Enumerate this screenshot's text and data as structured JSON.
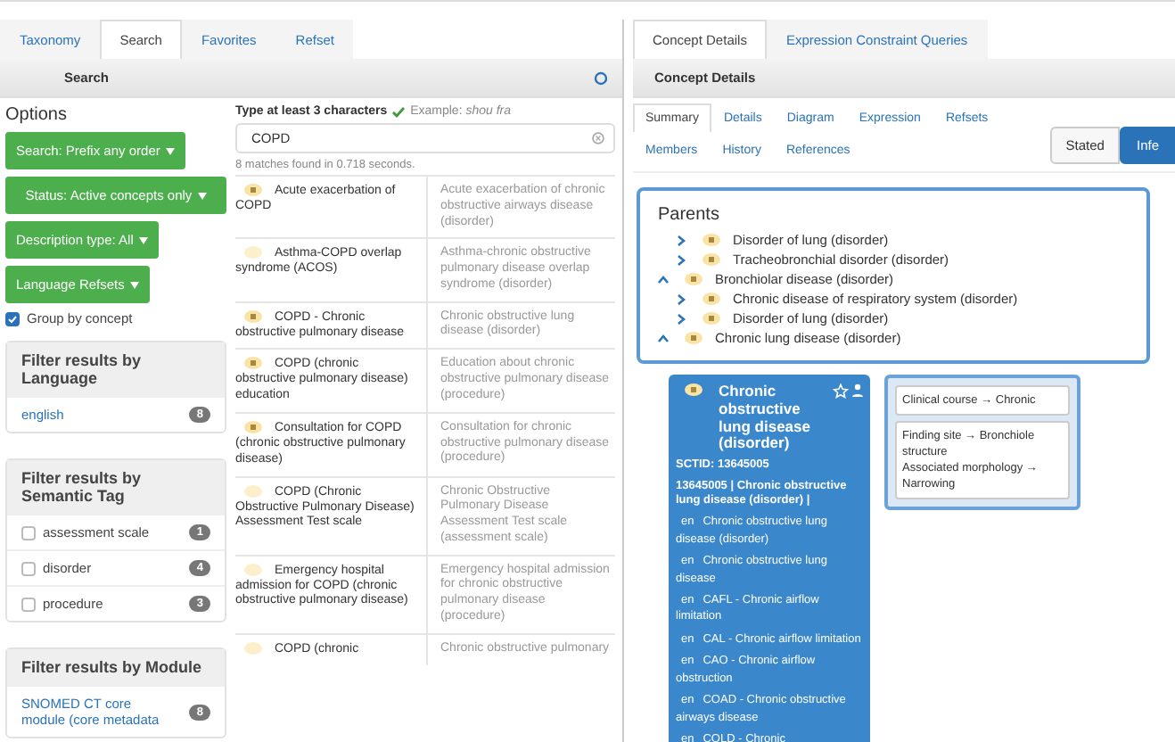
{
  "left_tabs": [
    {
      "label": "Taxonomy",
      "selected": false
    },
    {
      "label": "Search",
      "selected": true
    },
    {
      "label": "Favorites",
      "selected": false
    },
    {
      "label": "Refset",
      "selected": false
    }
  ],
  "search_header": {
    "title": "Search"
  },
  "options": {
    "title": "Options",
    "buttons": [
      "Search: Prefix any order",
      "Status: Active concepts only",
      "Description type: All",
      "Language Refsets"
    ],
    "group_by_concept": {
      "label": "Group by concept",
      "checked": true
    },
    "language_filter": {
      "title": "Filter results by Language",
      "items": [
        {
          "label": "english",
          "count": "8"
        }
      ]
    },
    "semantic_filter": {
      "title": "Filter results by Semantic Tag",
      "items": [
        {
          "label": "assessment scale",
          "count": "1",
          "checked": false
        },
        {
          "label": "disorder",
          "count": "4",
          "checked": false
        },
        {
          "label": "procedure",
          "count": "3",
          "checked": false
        }
      ]
    },
    "module_filter": {
      "title": "Filter results by Module",
      "items": [
        {
          "label": "SNOMED CT core module (core metadata",
          "count": "8"
        }
      ]
    }
  },
  "search": {
    "hint": "Type at least 3 characters",
    "example_label": "Example:",
    "example": "shou fra",
    "value": "COPD",
    "status": "8 matches found in 0.718 seconds.",
    "results": [
      {
        "term": "Acute exacerbation of COPD",
        "fsn": "Acute exacerbation of chronic obstructive airways disease (disorder)",
        "primitive": true
      },
      {
        "term": "Asthma-COPD overlap syndrome (ACOS)",
        "fsn": "Asthma-chronic obstructive pulmonary disease overlap syndrome (disorder)",
        "primitive": false
      },
      {
        "term": "COPD - Chronic obstructive pulmonary disease",
        "fsn": "Chronic obstructive lung disease (disorder)",
        "primitive": true
      },
      {
        "term": "COPD (chronic obstructive pulmonary disease) education",
        "fsn": "Education about chronic obstructive pulmonary disease (procedure)",
        "primitive": true
      },
      {
        "term": "Consultation for COPD (chronic obstructive pulmonary disease)",
        "fsn": "Consultation for chronic obstructive pulmonary disease (procedure)",
        "primitive": true
      },
      {
        "term": "COPD (Chronic Obstructive Pulmonary Disease) Assessment Test scale",
        "fsn": "Chronic Obstructive Pulmonary Disease Assessment Test scale (assessment scale)",
        "primitive": false
      },
      {
        "term": "Emergency hospital admission for COPD (chronic obstructive pulmonary disease)",
        "fsn": "Emergency hospital admission for chronic obstructive pulmonary disease (procedure)",
        "primitive": false
      },
      {
        "term": "COPD (chronic",
        "fsn": "Chronic obstructive pulmonary",
        "primitive": false
      }
    ]
  },
  "right_tabs": [
    {
      "label": "Concept Details",
      "selected": true
    },
    {
      "label": "Expression Constraint Queries",
      "selected": false
    }
  ],
  "details_header": {
    "title": "Concept Details"
  },
  "detail_tabs": [
    {
      "label": "Summary",
      "selected": true
    },
    {
      "label": "Details",
      "selected": false
    },
    {
      "label": "Diagram",
      "selected": false
    },
    {
      "label": "Expression",
      "selected": false
    },
    {
      "label": "Refsets",
      "selected": false
    },
    {
      "label": "Members",
      "selected": false
    },
    {
      "label": "History",
      "selected": false
    },
    {
      "label": "References",
      "selected": false
    }
  ],
  "view_toggle": [
    {
      "label": "Stated",
      "selected": false
    },
    {
      "label": "Infe",
      "selected": true
    }
  ],
  "parents": {
    "title": "Parents",
    "items": [
      {
        "label": "Disorder of lung (disorder)",
        "expanded": false
      },
      {
        "label": "Tracheobronchial disorder (disorder)",
        "expanded": false
      },
      {
        "label": "Bronchiolar disease (disorder)",
        "expanded": true
      },
      {
        "label": "Chronic disease of respiratory system (disorder)",
        "expanded": false
      },
      {
        "label": "Disorder of lung (disorder)",
        "expanded": false
      },
      {
        "label": "Chronic lung disease (disorder)",
        "expanded": true
      }
    ]
  },
  "concept": {
    "title": "Chronic obstructive lung disease (disorder)",
    "sctid": "SCTID: 13645005",
    "full": "13645005 | Chronic obstructive lung disease (disorder) |",
    "descriptions": [
      {
        "lang": "en",
        "text": "Chronic obstructive lung disease (disorder)"
      },
      {
        "lang": "en",
        "text": "Chronic obstructive lung disease"
      },
      {
        "lang": "en",
        "text": "CAFL - Chronic airflow limitation"
      },
      {
        "lang": "en",
        "text": "CAL - Chronic airflow limitation"
      },
      {
        "lang": "en",
        "text": "CAO - Chronic airflow obstruction"
      },
      {
        "lang": "en",
        "text": "COAD - Chronic obstructive airways disease"
      },
      {
        "lang": "en",
        "text": "COLD - Chronic"
      }
    ]
  },
  "relationships": [
    {
      "lines": [
        "Clinical course → Chronic"
      ]
    },
    {
      "lines": [
        "Finding site → Bronchiole structure",
        "Associated morphology → Narrowing"
      ]
    }
  ]
}
